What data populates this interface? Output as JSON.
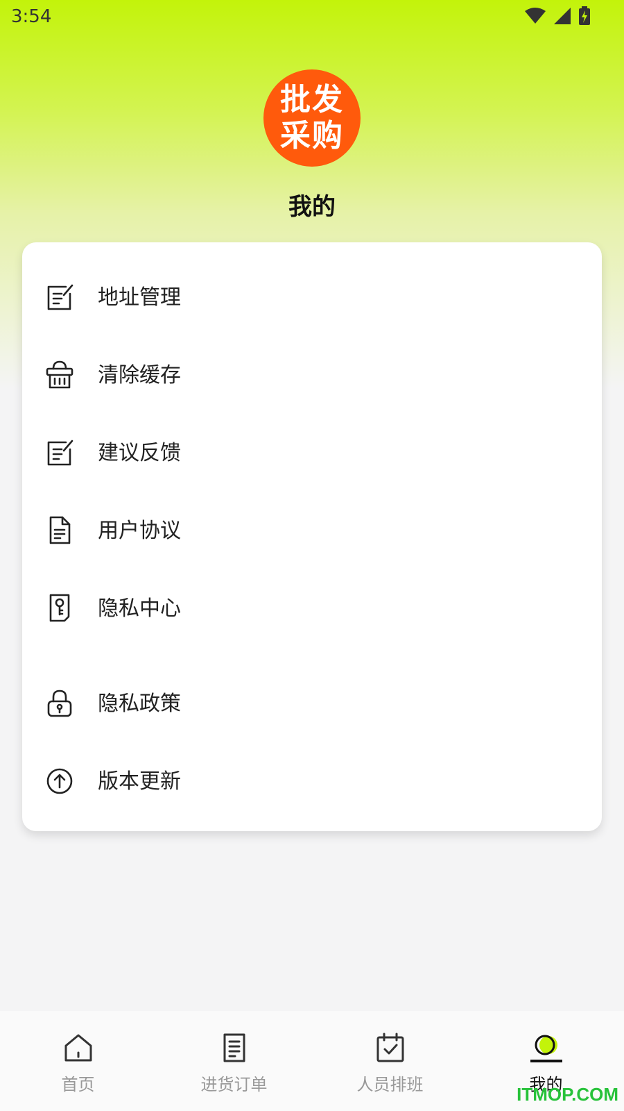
{
  "status_bar": {
    "time": "3:54"
  },
  "logo": {
    "line1": "批发",
    "line2": "采购",
    "color": "#ff5a0c"
  },
  "page": {
    "title": "我的"
  },
  "menu": [
    {
      "label": "地址管理",
      "icon": "edit-note-icon"
    },
    {
      "label": "清除缓存",
      "icon": "basket-icon"
    },
    {
      "label": "建议反馈",
      "icon": "edit-note-icon"
    },
    {
      "label": "用户协议",
      "icon": "document-icon"
    },
    {
      "label": "隐私中心",
      "icon": "key-document-icon"
    },
    {
      "label": "隐私政策",
      "icon": "lock-icon"
    },
    {
      "label": "版本更新",
      "icon": "arrow-up-circle-icon"
    }
  ],
  "nav": [
    {
      "label": "首页",
      "icon": "home-icon"
    },
    {
      "label": "进货订单",
      "icon": "list-icon"
    },
    {
      "label": "人员排班",
      "icon": "calendar-check-icon"
    },
    {
      "label": "我的",
      "icon": "profile-icon",
      "active": true
    }
  ],
  "watermark": "ITMOP.COM",
  "colors": {
    "accent": "#c3f30a",
    "brand": "#ff5a0c"
  }
}
